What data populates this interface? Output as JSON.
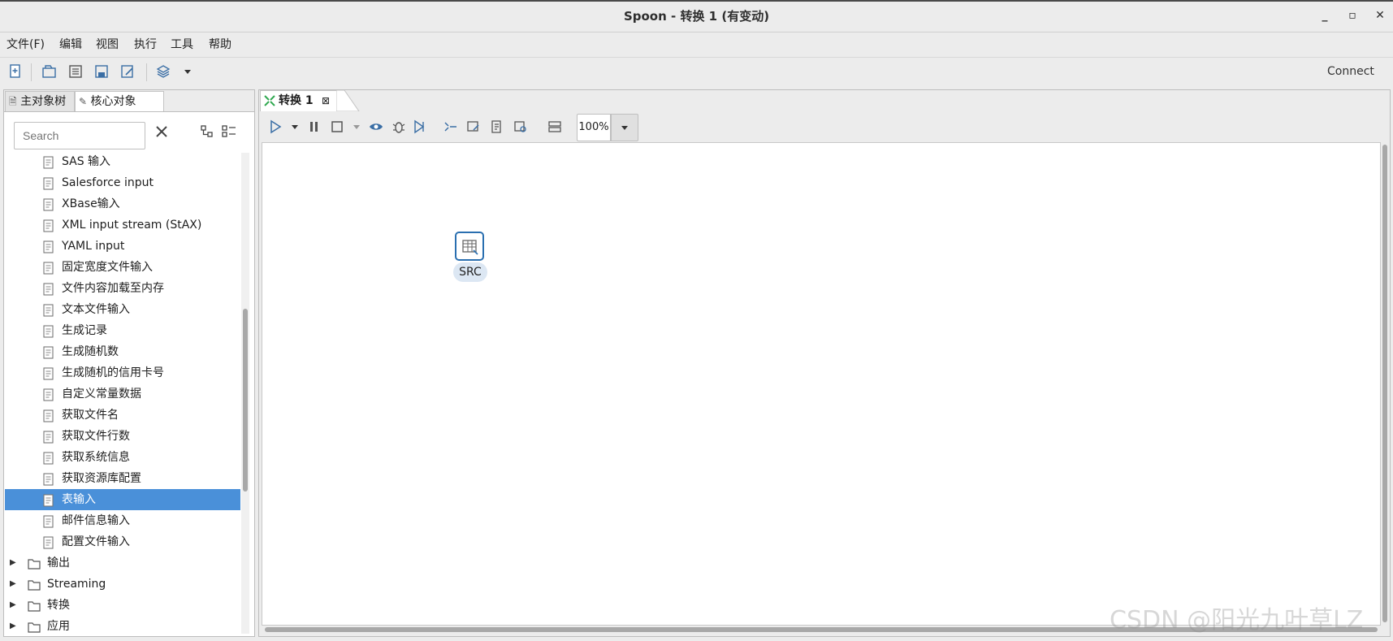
{
  "window": {
    "title": "Spoon - 转换 1 (有变动)",
    "minimize": "_",
    "maximize": "▫",
    "close": "✕"
  },
  "menu": [
    "文件(F)",
    "编辑",
    "视图",
    "执行",
    "工具",
    "帮助"
  ],
  "toolbar": {
    "connect_label": "Connect"
  },
  "left_tabs": {
    "main": "主对象树",
    "core": "核心对象"
  },
  "search": {
    "placeholder": "Search"
  },
  "tree_items": [
    {
      "label": "SAS 输入",
      "icon": "sas-icon"
    },
    {
      "label": "Salesforce input",
      "icon": "salesforce-icon"
    },
    {
      "label": "XBase输入",
      "icon": "xbase-icon"
    },
    {
      "label": "XML input stream (StAX)",
      "icon": "xml-icon"
    },
    {
      "label": "YAML input",
      "icon": "yaml-icon"
    },
    {
      "label": "固定宽度文件输入",
      "icon": "file-icon"
    },
    {
      "label": "文件内容加载至内存",
      "icon": "file-icon"
    },
    {
      "label": "文本文件输入",
      "icon": "file-icon"
    },
    {
      "label": "生成记录",
      "icon": "generate-icon"
    },
    {
      "label": "生成随机数",
      "icon": "random-icon"
    },
    {
      "label": "生成随机的信用卡号",
      "icon": "card-icon"
    },
    {
      "label": "自定义常量数据",
      "icon": "grid-icon"
    },
    {
      "label": "获取文件名",
      "icon": "file-icon"
    },
    {
      "label": "获取文件行数",
      "icon": "file-icon"
    },
    {
      "label": "获取系统信息",
      "icon": "system-icon"
    },
    {
      "label": "获取资源库配置",
      "icon": "file-icon"
    },
    {
      "label": "表输入",
      "icon": "table-icon"
    },
    {
      "label": "邮件信息输入",
      "icon": "mail-icon"
    },
    {
      "label": "配置文件输入",
      "icon": "file-icon"
    }
  ],
  "tree_folders": [
    "输出",
    "Streaming",
    "转换",
    "应用"
  ],
  "editor_tab": {
    "label": "转换 1",
    "close": "⊠"
  },
  "zoom": {
    "value": "100%"
  },
  "step": {
    "label": "SRC"
  },
  "watermark": "CSDN @阳光九叶草LZ",
  "colors": {
    "selection": "#4a90d9",
    "step_border": "#2a6fb0"
  }
}
